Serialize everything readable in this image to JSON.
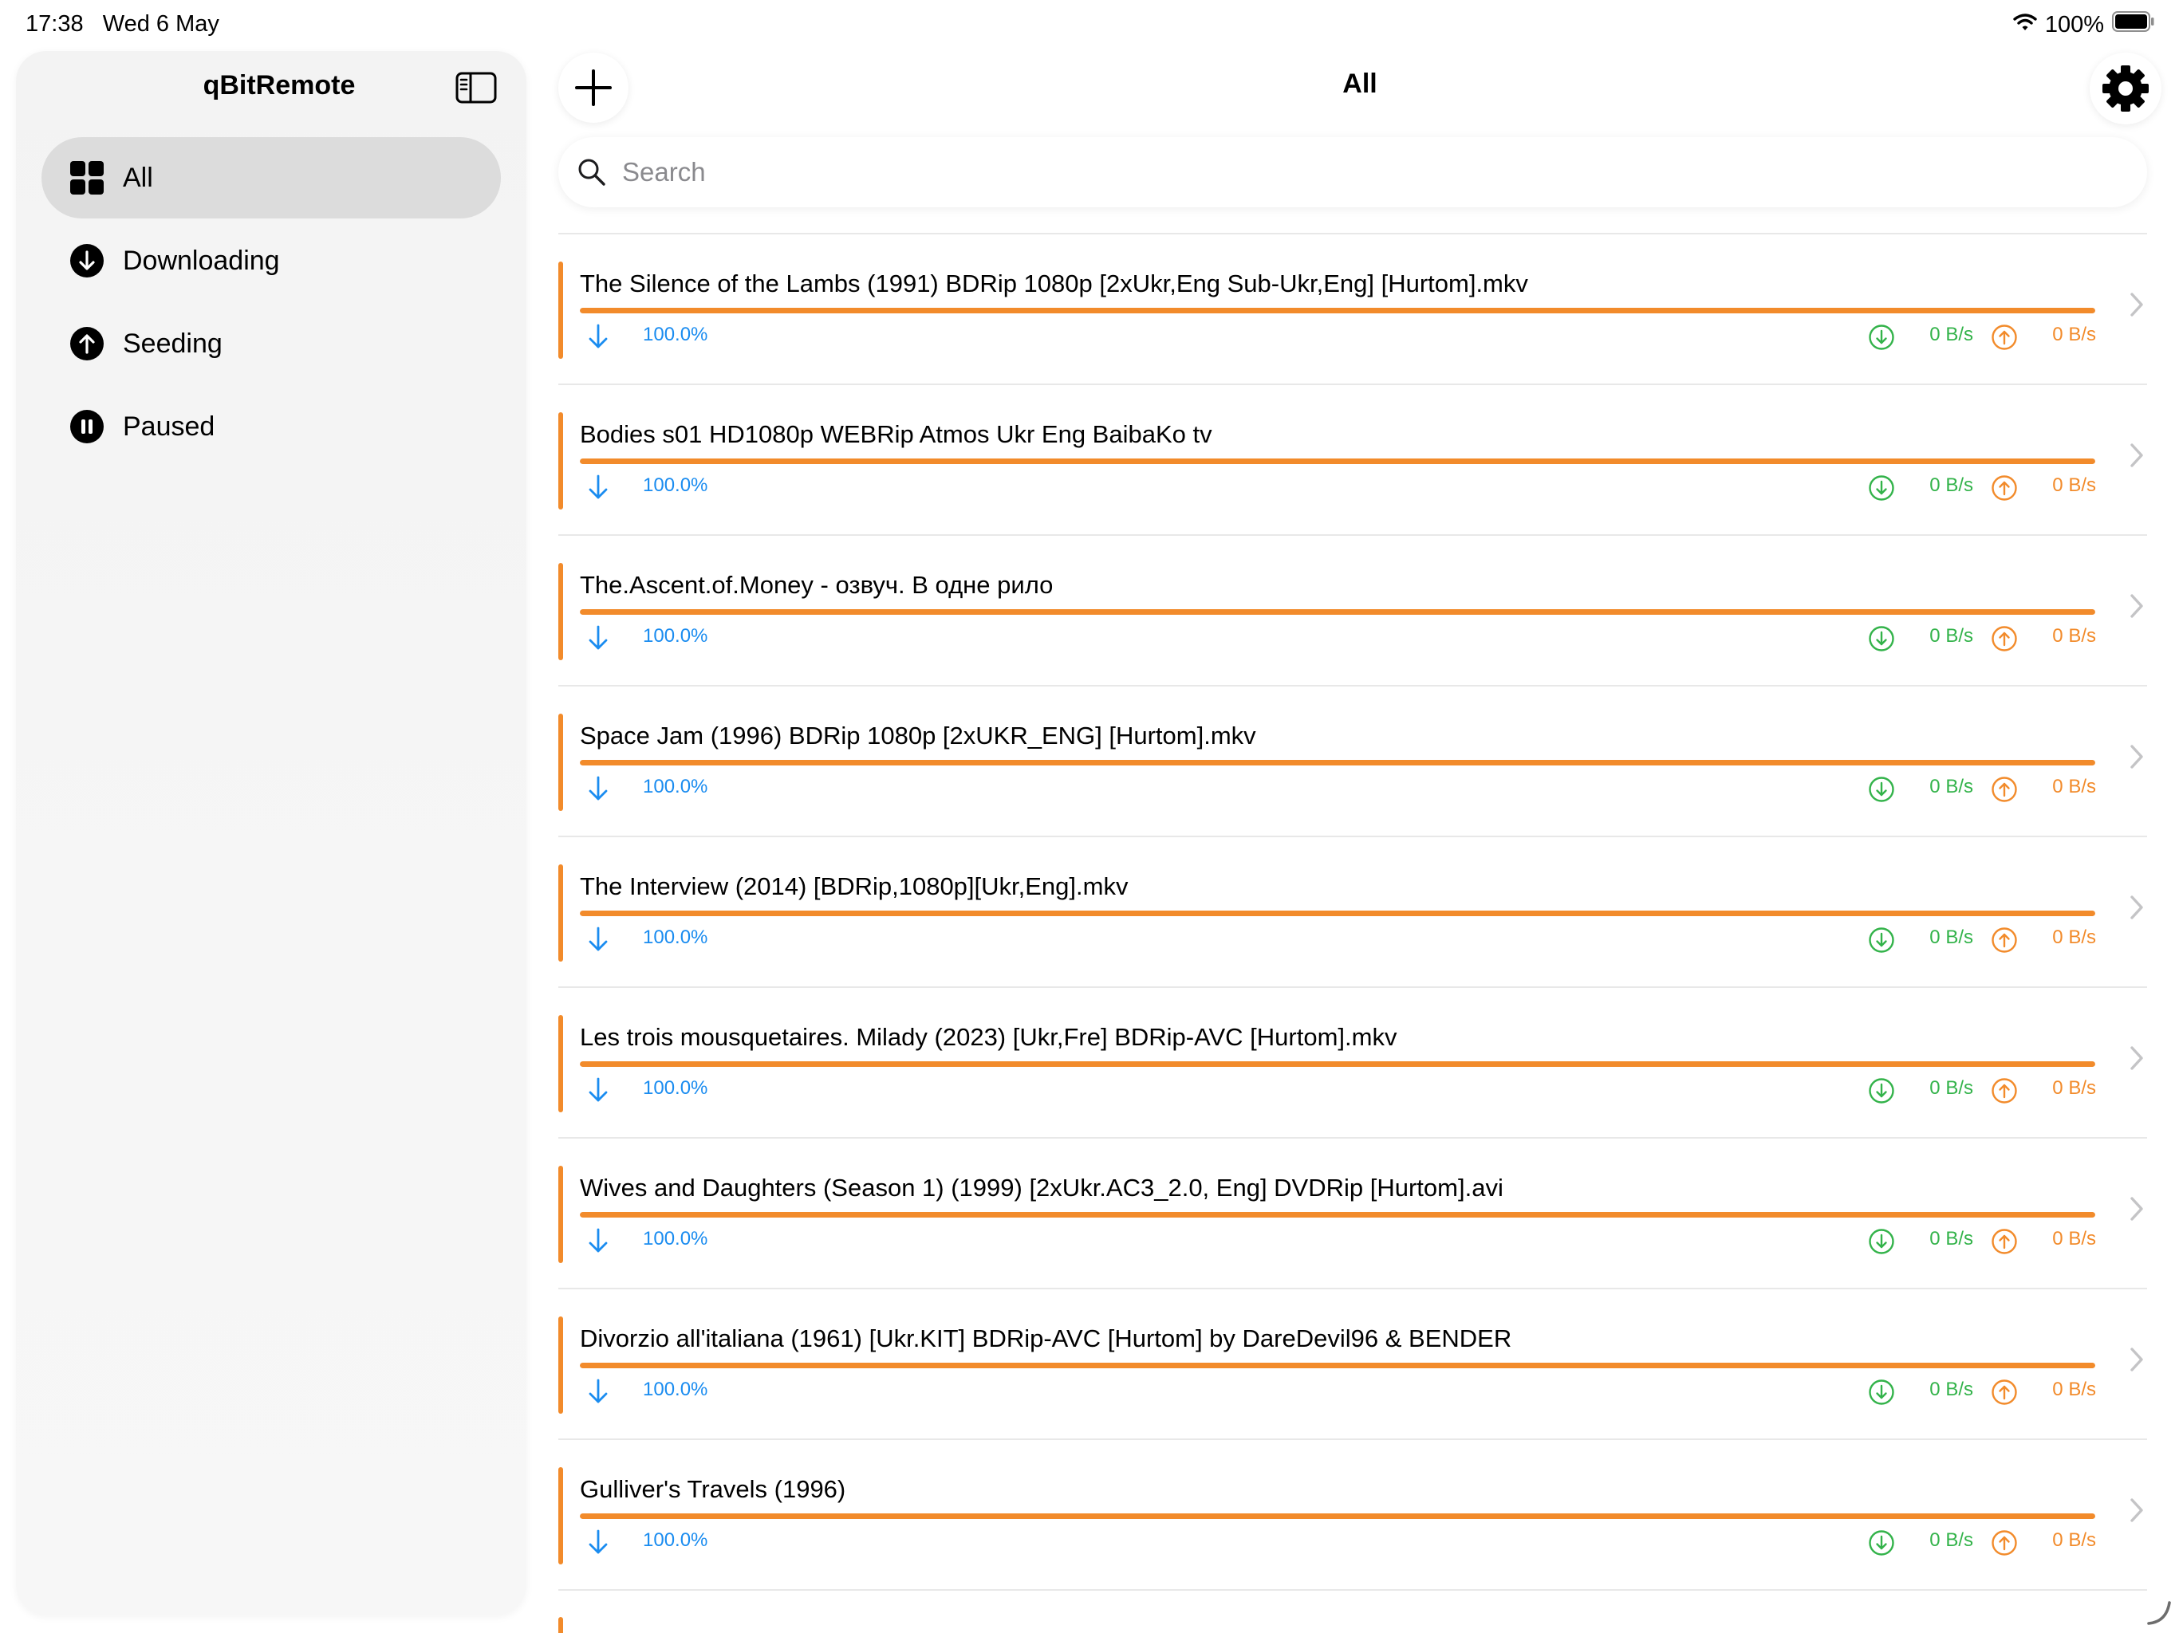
{
  "status_bar": {
    "time": "17:38",
    "date": "Wed 6 May",
    "battery": "100%"
  },
  "sidebar": {
    "title": "qBitRemote",
    "items": [
      {
        "label": "All",
        "icon": "grid-icon",
        "selected": true
      },
      {
        "label": "Downloading",
        "icon": "arrow-down-circle-icon",
        "selected": false
      },
      {
        "label": "Seeding",
        "icon": "arrow-up-circle-icon",
        "selected": false
      },
      {
        "label": "Paused",
        "icon": "pause-circle-icon",
        "selected": false
      }
    ]
  },
  "header": {
    "title": "All"
  },
  "search": {
    "placeholder": "Search"
  },
  "colors": {
    "accent": "#f28b2b",
    "progress_text": "#1a8cf0",
    "download_speed": "#33b34a",
    "upload_speed": "#f28b2b"
  },
  "torrents": [
    {
      "name": "The Silence of the Lambs (1991) BDRip 1080p [2xUkr,Eng Sub-Ukr,Eng] [Hurtom].mkv",
      "progress": 100,
      "progress_label": "100.0%",
      "download_speed": "0 B/s",
      "upload_speed": "0 B/s"
    },
    {
      "name": "Bodies s01 HD1080p WEBRip Atmos Ukr Eng BaibaKo tv",
      "progress": 100,
      "progress_label": "100.0%",
      "download_speed": "0 B/s",
      "upload_speed": "0 B/s"
    },
    {
      "name": "The.Ascent.of.Money - озвуч. В одне рило",
      "progress": 100,
      "progress_label": "100.0%",
      "download_speed": "0 B/s",
      "upload_speed": "0 B/s"
    },
    {
      "name": "Space Jam (1996) BDRip 1080p [2xUKR_ENG] [Hurtom].mkv",
      "progress": 100,
      "progress_label": "100.0%",
      "download_speed": "0 B/s",
      "upload_speed": "0 B/s"
    },
    {
      "name": "The Interview (2014) [BDRip,1080p][Ukr,Eng].mkv",
      "progress": 100,
      "progress_label": "100.0%",
      "download_speed": "0 B/s",
      "upload_speed": "0 B/s"
    },
    {
      "name": "Les trois mousquetaires. Milady (2023) [Ukr,Fre] BDRip-AVC [Hurtom].mkv",
      "progress": 100,
      "progress_label": "100.0%",
      "download_speed": "0 B/s",
      "upload_speed": "0 B/s"
    },
    {
      "name": "Wives and Daughters (Season 1) (1999) [2xUkr.AC3_2.0, Eng] DVDRip [Hurtom].avi",
      "progress": 100,
      "progress_label": "100.0%",
      "download_speed": "0 B/s",
      "upload_speed": "0 B/s"
    },
    {
      "name": "Divorzio all'italiana (1961) [Ukr.KIT] BDRip-AVC [Hurtom] by DareDevil96 & BENDER",
      "progress": 100,
      "progress_label": "100.0%",
      "download_speed": "0 B/s",
      "upload_speed": "0 B/s"
    },
    {
      "name": "Gulliver's Travels (1996)",
      "progress": 100,
      "progress_label": "100.0%",
      "download_speed": "0 B/s",
      "upload_speed": "0 B/s"
    }
  ]
}
